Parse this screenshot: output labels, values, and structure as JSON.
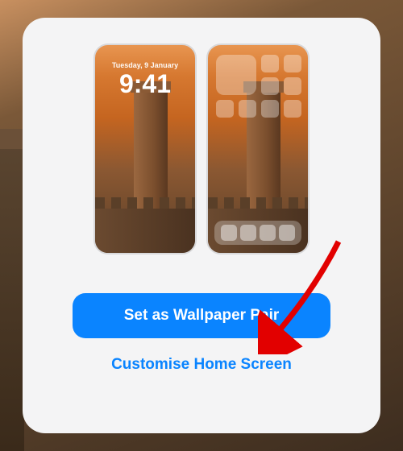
{
  "lockscreen": {
    "date": "Tuesday, 9 January",
    "time": "9:41"
  },
  "buttons": {
    "primary": "Set as Wallpaper Pair",
    "secondary": "Customise Home Screen"
  },
  "annotation": {
    "arrow_color": "#e20000"
  }
}
